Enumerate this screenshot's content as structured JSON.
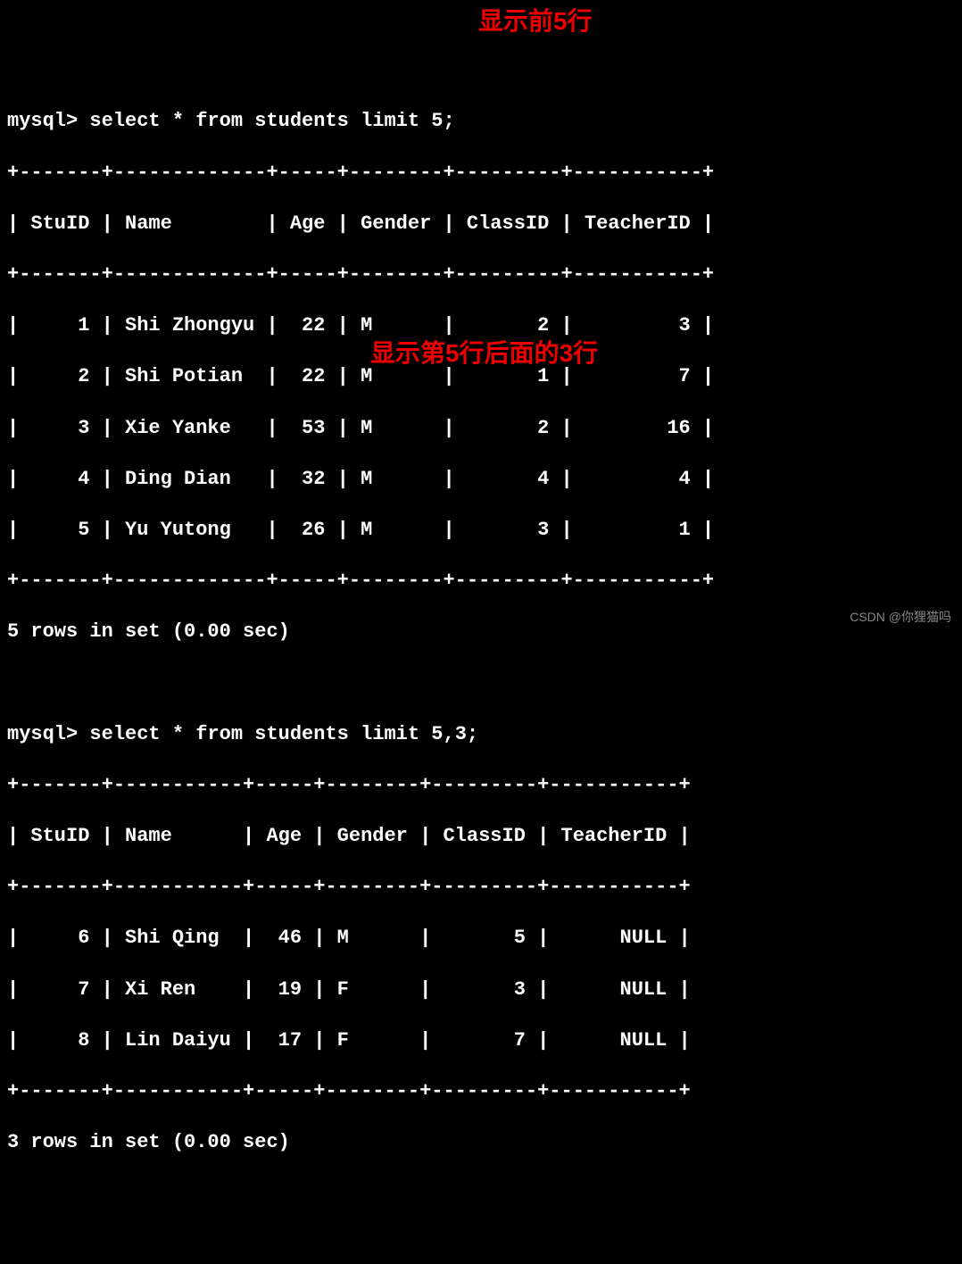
{
  "query1": {
    "prompt": "mysql> ",
    "sql": "select * from students limit 5;",
    "annotation": "显示前5行",
    "columns": [
      "StuID",
      "Name",
      "Age",
      "Gender",
      "ClassID",
      "TeacherID"
    ],
    "rows": [
      {
        "StuID": "1",
        "Name": "Shi Zhongyu",
        "Age": "22",
        "Gender": "M",
        "ClassID": "2",
        "TeacherID": "3"
      },
      {
        "StuID": "2",
        "Name": "Shi Potian",
        "Age": "22",
        "Gender": "M",
        "ClassID": "1",
        "TeacherID": "7"
      },
      {
        "StuID": "3",
        "Name": "Xie Yanke",
        "Age": "53",
        "Gender": "M",
        "ClassID": "2",
        "TeacherID": "16"
      },
      {
        "StuID": "4",
        "Name": "Ding Dian",
        "Age": "32",
        "Gender": "M",
        "ClassID": "4",
        "TeacherID": "4"
      },
      {
        "StuID": "5",
        "Name": "Yu Yutong",
        "Age": "26",
        "Gender": "M",
        "ClassID": "3",
        "TeacherID": "1"
      }
    ],
    "result_msg": "5 rows in set (0.00 sec)"
  },
  "query2": {
    "prompt": "mysql> ",
    "sql": "select * from students limit 5,3;",
    "annotation": "显示第5行后面的3行",
    "columns": [
      "StuID",
      "Name",
      "Age",
      "Gender",
      "ClassID",
      "TeacherID"
    ],
    "rows": [
      {
        "StuID": "6",
        "Name": "Shi Qing",
        "Age": "46",
        "Gender": "M",
        "ClassID": "5",
        "TeacherID": "NULL"
      },
      {
        "StuID": "7",
        "Name": "Xi Ren",
        "Age": "19",
        "Gender": "F",
        "ClassID": "3",
        "TeacherID": "NULL"
      },
      {
        "StuID": "8",
        "Name": "Lin Daiyu",
        "Age": "17",
        "Gender": "F",
        "ClassID": "7",
        "TeacherID": "NULL"
      }
    ],
    "result_msg": "3 rows in set (0.00 sec)"
  },
  "watermark": "CSDN @你狸猫吗",
  "borders": {
    "q1_border": "+-------+-------------+-----+--------+---------+-----------+",
    "q1_header": "| StuID | Name        | Age | Gender | ClassID | TeacherID |",
    "q2_border": "+-------+-----------+-----+--------+---------+-----------+",
    "q2_header": "| StuID | Name      | Age | Gender | ClassID | TeacherID |"
  },
  "rows_fmt": {
    "q1_r0": "|     1 | Shi Zhongyu |  22 | M      |       2 |         3 |",
    "q1_r1": "|     2 | Shi Potian  |  22 | M      |       1 |         7 |",
    "q1_r2": "|     3 | Xie Yanke   |  53 | M      |       2 |        16 |",
    "q1_r3": "|     4 | Ding Dian   |  32 | M      |       4 |         4 |",
    "q1_r4": "|     5 | Yu Yutong   |  26 | M      |       3 |         1 |",
    "q2_r0": "|     6 | Shi Qing  |  46 | M      |       5 |      NULL |",
    "q2_r1": "|     7 | Xi Ren    |  19 | F      |       3 |      NULL |",
    "q2_r2": "|     8 | Lin Daiyu |  17 | F      |       7 |      NULL |"
  }
}
